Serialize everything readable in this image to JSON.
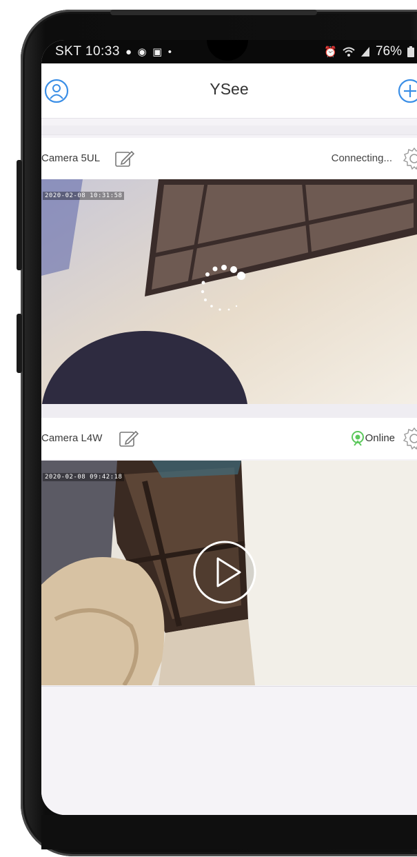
{
  "status_bar": {
    "carrier_time": "SKT 10:33",
    "notification_icons": [
      "chat-bubble-icon",
      "c-circle-icon",
      "b-square-icon",
      "dot-icon"
    ],
    "battery": "76%",
    "right_icons": [
      "alarm-icon",
      "wifi-icon",
      "signal-icon",
      "battery-icon"
    ]
  },
  "header": {
    "title": "YSee",
    "left_icon": "user-icon",
    "right_icon": "add-icon"
  },
  "cameras": [
    {
      "name": "Camera 5UL",
      "status": "Connecting...",
      "timestamp": "2020-02-08 10:31:58",
      "overlay": "loading-spinner"
    },
    {
      "name": "Camera L4W",
      "status": "Online",
      "timestamp": "2020-02-08 09:42:18",
      "overlay": "play-button"
    }
  ],
  "colors": {
    "accent_blue": "#3a8ee6",
    "online_green": "#5cc85c",
    "background": "#f5f3f7"
  }
}
